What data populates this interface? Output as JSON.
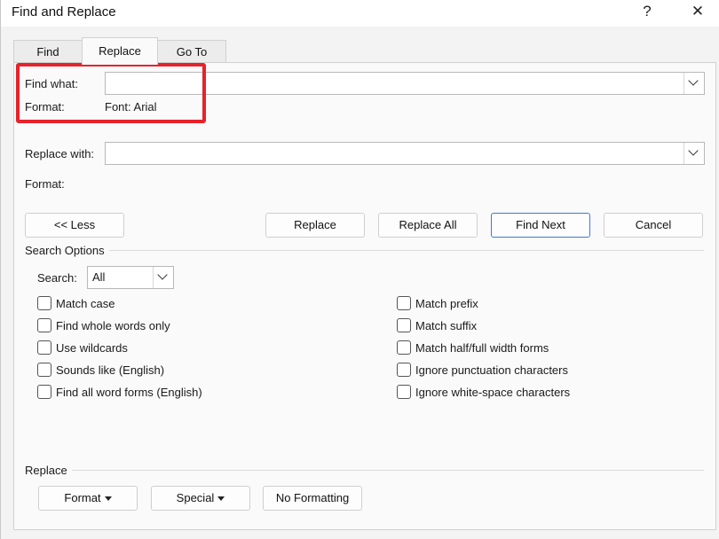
{
  "window": {
    "title": "Find and Replace",
    "help_glyph": "?",
    "close_glyph": "✕"
  },
  "tabs": [
    {
      "label": "Find",
      "active": false
    },
    {
      "label": "Replace",
      "active": true
    },
    {
      "label": "Go To",
      "active": false
    }
  ],
  "find": {
    "label": "Find what:",
    "value": "",
    "format_label": "Format:",
    "format_value": "Font: Arial"
  },
  "replace": {
    "label": "Replace with:",
    "value": "",
    "format_label": "Format:",
    "format_value": ""
  },
  "buttons": {
    "less": "<< Less",
    "replace": "Replace",
    "replace_all": "Replace All",
    "find_next": "Find Next",
    "cancel": "Cancel"
  },
  "search_options": {
    "heading": "Search Options",
    "search_label": "Search:",
    "search_value": "All",
    "left_checks": [
      {
        "label": "Match case",
        "checked": false
      },
      {
        "label": "Find whole words only",
        "checked": false
      },
      {
        "label": "Use wildcards",
        "checked": false
      },
      {
        "label": "Sounds like (English)",
        "checked": false
      },
      {
        "label": "Find all word forms (English)",
        "checked": false
      }
    ],
    "right_checks": [
      {
        "label": "Match prefix",
        "checked": false
      },
      {
        "label": "Match suffix",
        "checked": false
      },
      {
        "label": "Match half/full width forms",
        "checked": false
      },
      {
        "label": "Ignore punctuation characters",
        "checked": false
      },
      {
        "label": "Ignore white-space characters",
        "checked": false
      }
    ]
  },
  "replace_section": {
    "heading": "Replace",
    "format": "Format",
    "special": "Special",
    "no_formatting": "No Formatting"
  },
  "colors": {
    "highlight": "#e8222a",
    "primary_border": "#3b7bd3"
  }
}
